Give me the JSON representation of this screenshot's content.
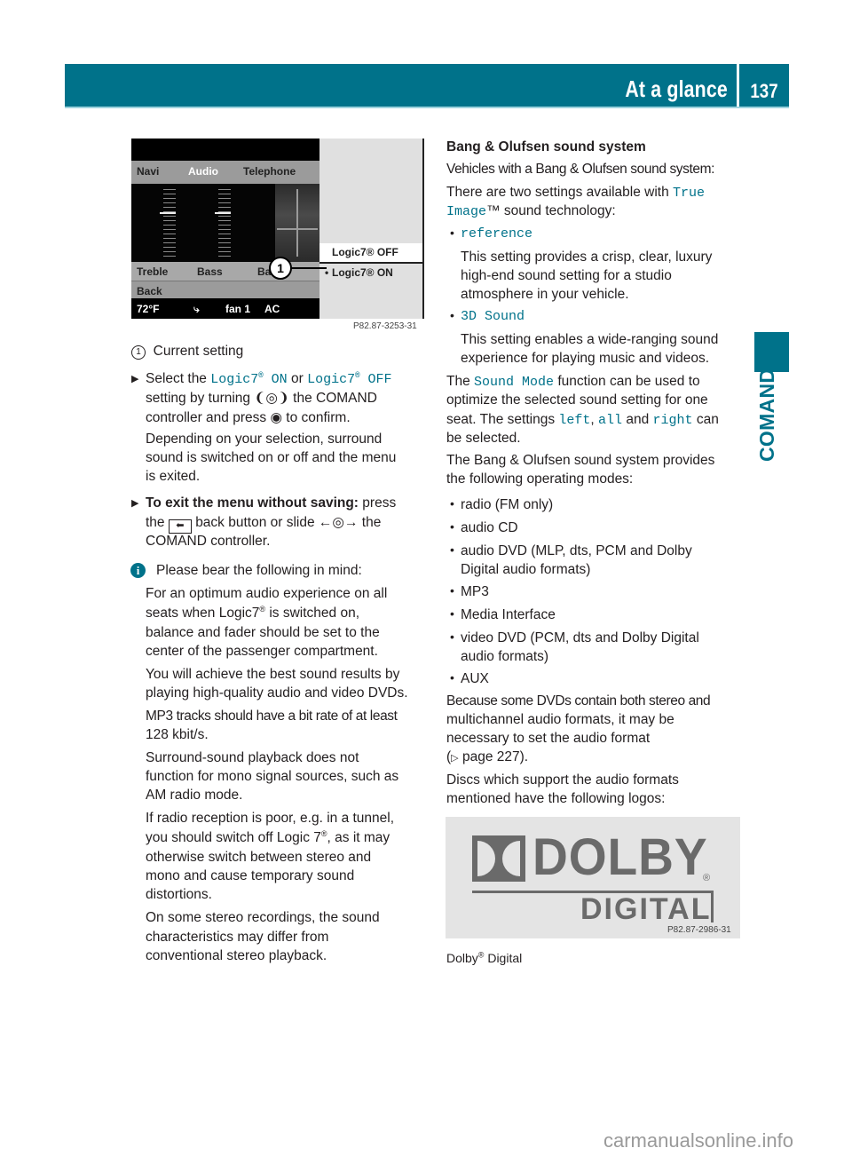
{
  "header": {
    "title": "At a glance",
    "page_number": "137",
    "section_tab": "COMAND",
    "accent_color": "#00728a"
  },
  "figure1": {
    "tabs": [
      "Navi",
      "Audio",
      "Telephone"
    ],
    "controls_row": [
      "Treble",
      "Bass",
      "Bal/Fa"
    ],
    "back_label": "Back",
    "status_bar": [
      "72°F",
      "seat-heat-icon",
      "fan 1",
      "AC"
    ],
    "menu_options": [
      "Logic7® OFF",
      "Logic7® ON"
    ],
    "selected_option": "Logic7® ON",
    "callout_number": "1",
    "figure_code": "P82.87-3253-31"
  },
  "left_column": {
    "callout_legend": {
      "number": "1",
      "text": "Current setting"
    },
    "step1": {
      "pre": "Select the",
      "opt_on": "Logic7",
      "opt_on_suffix": " ON",
      "mid": "or",
      "opt_off": "Logic7",
      "opt_off_suffix": " OFF",
      "reg": "®",
      "line2_pre": "setting by turning",
      "line2_post": "the COMAND",
      "line3_pre": "controller and press",
      "line3_post": "to confirm.",
      "line4": "Depending on your selection, surround",
      "line5": "sound is switched on or off and the menu",
      "line6": "is exited."
    },
    "step2": {
      "bold": "To exit the menu without saving:",
      "post": "press",
      "line2_pre": "the",
      "line2_mid": "back button or slide",
      "line2_post": "the",
      "line3": "COMAND controller."
    },
    "note": {
      "heading": "Please bear the following in mind:",
      "p1": [
        "For an optimum audio experience on all",
        "seats when Logic7",
        "is switched on,",
        "balance and fader should be set to the",
        "center of the passenger compartment."
      ],
      "p2": [
        "You will achieve the best sound results by",
        "playing high-quality audio and video DVDs."
      ],
      "p3": [
        "MP3 tracks should have a bit rate of at least",
        "128 kbit/s."
      ],
      "p4": [
        "Surround-sound playback does not",
        "function for mono signal sources, such as",
        "AM radio mode."
      ],
      "p5": [
        "If radio reception is poor, e.g. in a tunnel,",
        "you should switch off Logic 7",
        ", as it may",
        "otherwise switch between stereo and",
        "mono and cause temporary sound",
        "distortions."
      ],
      "p6": [
        "On some stereo recordings, the sound",
        "characteristics may differ from",
        "conventional stereo playback."
      ]
    }
  },
  "right_column": {
    "heading": "Bang & Olufsen sound system",
    "intro": "Vehicles with a Bang & Olufsen sound system:",
    "settings_intro_pre": "There are two settings available with",
    "true_image_1": "True",
    "true_image_2": "Image",
    "settings_intro_post": "™ sound technology:",
    "settings": [
      {
        "name": "reference",
        "desc": [
          "This setting provides a crisp, clear, luxury",
          "high-end sound setting for a studio",
          "atmosphere in your vehicle."
        ]
      },
      {
        "name": "3D Sound",
        "desc": [
          "This setting enables a wide-ranging sound",
          "experience for playing music and videos."
        ]
      }
    ],
    "sound_mode": {
      "pre": "The",
      "name": "Sound Mode",
      "post": "function can be used to",
      "line2": "optimize the selected sound setting for one",
      "line3_pre": "seat. The settings",
      "left": "left",
      "all": "all",
      "and": "and",
      "right": "right",
      "line3_post": "can",
      "line4": "be selected."
    },
    "modes_intro": [
      "The Bang & Olufsen sound system provides",
      "the following operating modes:"
    ],
    "modes": [
      [
        "radio (FM only)"
      ],
      [
        "audio CD"
      ],
      [
        "audio DVD (MLP, dts, PCM and Dolby",
        "Digital audio formats)"
      ],
      [
        "MP3"
      ],
      [
        "Media Interface"
      ],
      [
        "video DVD (PCM, dts and Dolby Digital",
        "audio formats)"
      ],
      [
        "AUX"
      ]
    ],
    "dvd_note": [
      "Because some DVDs contain both stereo and",
      "multichannel audio formats, it may be",
      "necessary to set the audio format"
    ],
    "page_ref": "page 227",
    "logos_intro": [
      "Discs which support the audio formats",
      "mentioned have the following logos:"
    ],
    "logo": {
      "word": "DOLBY",
      "sub": "DIGITAL",
      "figure_code": "P82.87-2986-31"
    },
    "logo_caption_pre": "Dolby",
    "logo_caption_post": " Digital"
  },
  "watermark": "carmanualsonline.info"
}
